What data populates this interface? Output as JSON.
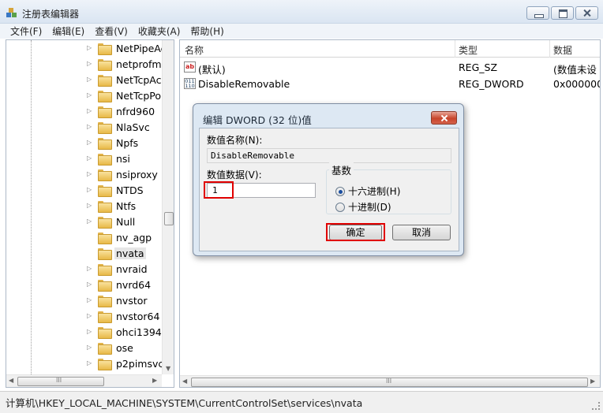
{
  "window": {
    "title": "注册表编辑器"
  },
  "menu": [
    "文件(F)",
    "编辑(E)",
    "查看(V)",
    "收藏夹(A)",
    "帮助(H)"
  ],
  "tree": {
    "items": [
      {
        "label": "NetPipeAc",
        "expandable": true
      },
      {
        "label": "netprofm",
        "expandable": true
      },
      {
        "label": "NetTcpAc",
        "expandable": true
      },
      {
        "label": "NetTcpPo",
        "expandable": true
      },
      {
        "label": "nfrd960",
        "expandable": true
      },
      {
        "label": "NlaSvc",
        "expandable": true
      },
      {
        "label": "Npfs",
        "expandable": true
      },
      {
        "label": "nsi",
        "expandable": true
      },
      {
        "label": "nsiproxy",
        "expandable": true
      },
      {
        "label": "NTDS",
        "expandable": true
      },
      {
        "label": "Ntfs",
        "expandable": true
      },
      {
        "label": "Null",
        "expandable": true
      },
      {
        "label": "nv_agp",
        "expandable": false
      },
      {
        "label": "nvata",
        "expandable": false,
        "selected": true
      },
      {
        "label": "nvraid",
        "expandable": true
      },
      {
        "label": "nvrd64",
        "expandable": true
      },
      {
        "label": "nvstor",
        "expandable": true
      },
      {
        "label": "nvstor64",
        "expandable": true
      },
      {
        "label": "ohci1394",
        "expandable": true
      },
      {
        "label": "ose",
        "expandable": true
      },
      {
        "label": "p2pimsvc",
        "expandable": true
      }
    ]
  },
  "list": {
    "columns": [
      "名称",
      "类型",
      "数据"
    ],
    "rows": [
      {
        "name": "(默认)",
        "type": "REG_SZ",
        "data": "(数值未设",
        "icon": "string-value-icon"
      },
      {
        "name": "DisableRemovable",
        "type": "REG_DWORD",
        "data": "0x000000",
        "icon": "dword-value-icon"
      }
    ]
  },
  "dialog": {
    "title": "编辑 DWORD (32 位)值",
    "name_label": "数值名称(N):",
    "name_value": "DisableRemovable",
    "data_label": "数值数据(V):",
    "data_value": "1",
    "base_label": "基数",
    "radio_hex": "十六进制(H)",
    "radio_dec": "十进制(D)",
    "selected_base": "hex",
    "ok_label": "确定",
    "cancel_label": "取消"
  },
  "status": {
    "path": "计算机\\HKEY_LOCAL_MACHINE\\SYSTEM\\CurrentControlSet\\services\\nvata"
  }
}
